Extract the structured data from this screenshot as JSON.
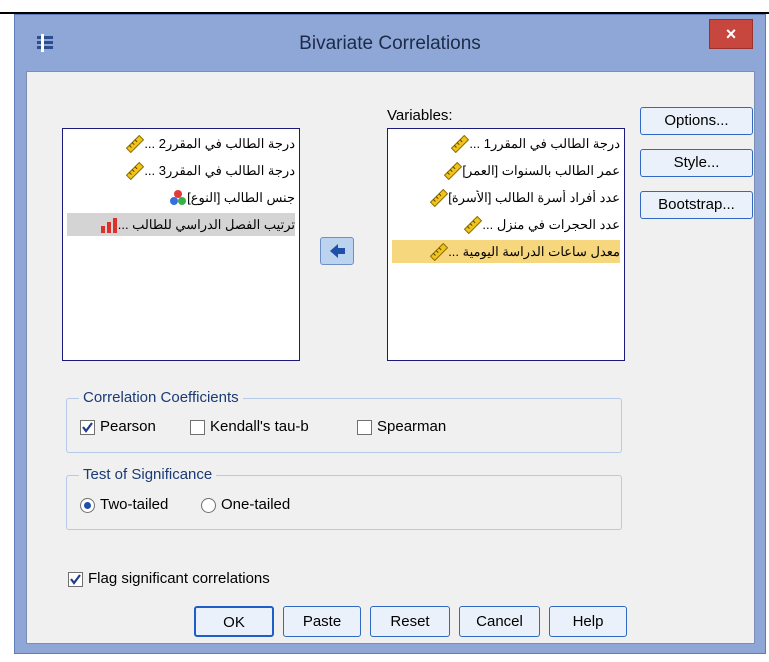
{
  "window": {
    "title": "Bivariate Correlations",
    "close_label": "×"
  },
  "source_list": {
    "items": [
      {
        "label": "درجة الطالب في المقرر2 ...",
        "icon": "scale-icon"
      },
      {
        "label": "درجة الطالب في المقرر3 ...",
        "icon": "scale-icon"
      },
      {
        "label": "جنس الطالب [النوع]",
        "icon": "nominal-icon"
      },
      {
        "label": "ترتيب الفصل الدراسي للطالب ...",
        "icon": "ordinal-icon"
      }
    ]
  },
  "variables": {
    "label": "Variables:",
    "items": [
      {
        "label": "درجة الطالب في المقرر1 ...",
        "icon": "scale-icon"
      },
      {
        "label": "عمر الطالب بالسنوات [العمر]",
        "icon": "scale-icon"
      },
      {
        "label": "عدد أفراد أسرة الطالب [الأسرة]",
        "icon": "scale-icon"
      },
      {
        "label": "عدد الحجرات في منزل ...",
        "icon": "scale-icon"
      },
      {
        "label": "معدل ساعات الدراسة اليومية ...",
        "icon": "scale-icon"
      }
    ]
  },
  "side_buttons": {
    "options": "Options...",
    "style": "Style...",
    "bootstrap": "Bootstrap..."
  },
  "correlation_coefficients": {
    "title": "Correlation Coefficients",
    "pearson": "Pearson",
    "kendall": "Kendall's tau-b",
    "spearman": "Spearman",
    "pearson_checked": true,
    "kendall_checked": false,
    "spearman_checked": false
  },
  "test_of_significance": {
    "title": "Test of Significance",
    "two_tailed": "Two-tailed",
    "one_tailed": "One-tailed",
    "selected": "Two-tailed"
  },
  "flag": {
    "label": "Flag significant correlations",
    "checked": true
  },
  "buttons": {
    "ok": "OK",
    "paste": "Paste",
    "reset": "Reset",
    "cancel": "Cancel",
    "help": "Help"
  },
  "colors": {
    "title_bar": "#8fa7d6",
    "close_button": "#c7463e",
    "selected_item": "#f7d77d",
    "dialog_bg": "#f0f0f0",
    "button_border": "#2f68c5"
  }
}
